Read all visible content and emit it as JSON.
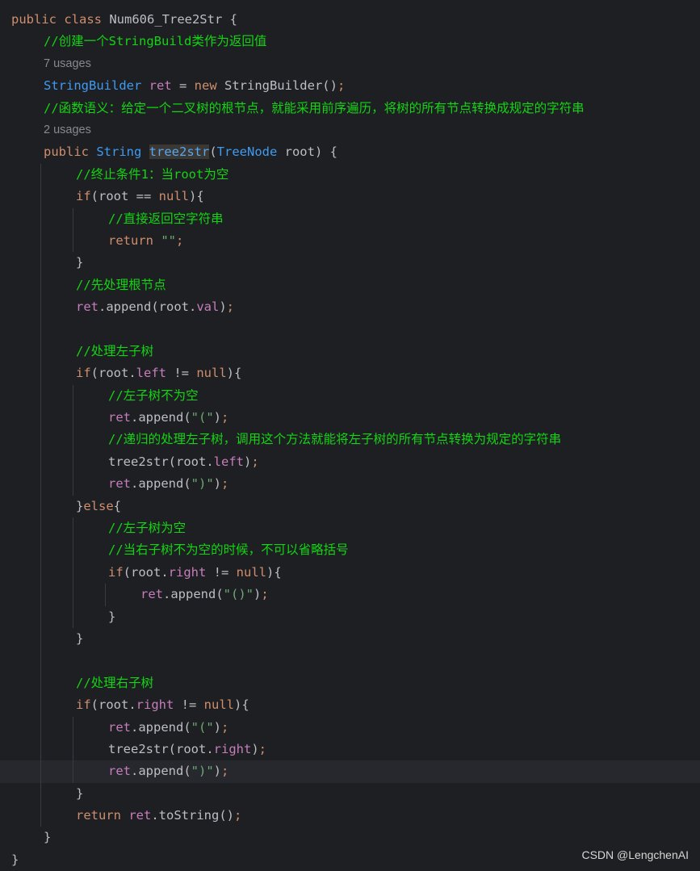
{
  "colors": {
    "background": "#1e1f22",
    "current_line": "#26282e",
    "keyword": "#cf8e6d",
    "plain": "#bcbec4",
    "type": "#3f9bf2",
    "field": "#c77dbb",
    "string": "#6aab73",
    "comment": "#14d414",
    "hint": "#868991"
  },
  "editor": {
    "lines": [
      {
        "indent": 0,
        "tokens": [
          {
            "t": "public class ",
            "c": "kw"
          },
          {
            "t": "Num606_Tree2Str",
            "c": "plain"
          },
          {
            "t": " {",
            "c": "plain"
          }
        ]
      },
      {
        "indent": 1,
        "tokens": [
          {
            "t": "//创建一个StringBuild类作为返回值",
            "c": "comment"
          }
        ]
      },
      {
        "indent": 1,
        "hint": true,
        "tokens": [
          {
            "t": "7 usages",
            "c": "hint"
          }
        ]
      },
      {
        "indent": 1,
        "tokens": [
          {
            "t": "StringBuilder ",
            "c": "type"
          },
          {
            "t": "ret",
            "c": "field"
          },
          {
            "t": " = ",
            "c": "plain"
          },
          {
            "t": "new",
            "c": "kw"
          },
          {
            "t": " StringBuilder()",
            "c": "plain"
          },
          {
            "t": ";",
            "c": "kw"
          }
        ]
      },
      {
        "indent": 1,
        "tokens": [
          {
            "t": "//函数语义：给定一个二叉树的根节点，就能采用前序遍历，将树的所有节点转换成规定的字符串",
            "c": "comment"
          }
        ]
      },
      {
        "indent": 1,
        "hint": true,
        "tokens": [
          {
            "t": "2 usages",
            "c": "hint"
          }
        ]
      },
      {
        "indent": 1,
        "tokens": [
          {
            "t": "public ",
            "c": "kw"
          },
          {
            "t": "String ",
            "c": "type"
          },
          {
            "t": "tree2str",
            "c": "method",
            "hl": true
          },
          {
            "t": "(",
            "c": "plain"
          },
          {
            "t": "TreeNode",
            "c": "type"
          },
          {
            "t": " root) {",
            "c": "plain"
          }
        ]
      },
      {
        "indent": 2,
        "tokens": [
          {
            "t": "//终止条件1：当root为空",
            "c": "comment"
          }
        ]
      },
      {
        "indent": 2,
        "tokens": [
          {
            "t": "if",
            "c": "kw"
          },
          {
            "t": "(root == ",
            "c": "plain"
          },
          {
            "t": "null",
            "c": "kw"
          },
          {
            "t": "){",
            "c": "plain"
          }
        ]
      },
      {
        "indent": 3,
        "tokens": [
          {
            "t": "//直接返回空字符串",
            "c": "comment"
          }
        ]
      },
      {
        "indent": 3,
        "tokens": [
          {
            "t": "return ",
            "c": "kw"
          },
          {
            "t": "\"\"",
            "c": "str"
          },
          {
            "t": ";",
            "c": "kw"
          }
        ]
      },
      {
        "indent": 2,
        "tokens": [
          {
            "t": "}",
            "c": "plain"
          }
        ]
      },
      {
        "indent": 2,
        "tokens": [
          {
            "t": "//先处理根节点",
            "c": "comment"
          }
        ]
      },
      {
        "indent": 2,
        "tokens": [
          {
            "t": "ret",
            "c": "field"
          },
          {
            "t": ".append(root.",
            "c": "plain"
          },
          {
            "t": "val",
            "c": "field"
          },
          {
            "t": ")",
            "c": "plain"
          },
          {
            "t": ";",
            "c": "kw"
          }
        ]
      },
      {
        "indent": 2,
        "tokens": []
      },
      {
        "indent": 2,
        "tokens": [
          {
            "t": "//处理左子树",
            "c": "comment"
          }
        ]
      },
      {
        "indent": 2,
        "tokens": [
          {
            "t": "if",
            "c": "kw"
          },
          {
            "t": "(root.",
            "c": "plain"
          },
          {
            "t": "left",
            "c": "field"
          },
          {
            "t": " != ",
            "c": "plain"
          },
          {
            "t": "null",
            "c": "kw"
          },
          {
            "t": "){",
            "c": "plain"
          }
        ]
      },
      {
        "indent": 3,
        "tokens": [
          {
            "t": "//左子树不为空",
            "c": "comment"
          }
        ]
      },
      {
        "indent": 3,
        "tokens": [
          {
            "t": "ret",
            "c": "field"
          },
          {
            "t": ".append(",
            "c": "plain"
          },
          {
            "t": "\"(\"",
            "c": "str"
          },
          {
            "t": ")",
            "c": "plain"
          },
          {
            "t": ";",
            "c": "kw"
          }
        ]
      },
      {
        "indent": 3,
        "tokens": [
          {
            "t": "//递归的处理左子树，调用这个方法就能将左子树的所有节点转换为规定的字符串",
            "c": "comment"
          }
        ]
      },
      {
        "indent": 3,
        "tokens": [
          {
            "t": "tree2str(root.",
            "c": "plain"
          },
          {
            "t": "left",
            "c": "field"
          },
          {
            "t": ")",
            "c": "plain"
          },
          {
            "t": ";",
            "c": "kw"
          }
        ]
      },
      {
        "indent": 3,
        "tokens": [
          {
            "t": "ret",
            "c": "field"
          },
          {
            "t": ".append(",
            "c": "plain"
          },
          {
            "t": "\")\"",
            "c": "str"
          },
          {
            "t": ")",
            "c": "plain"
          },
          {
            "t": ";",
            "c": "kw"
          }
        ]
      },
      {
        "indent": 2,
        "tokens": [
          {
            "t": "}",
            "c": "plain"
          },
          {
            "t": "else",
            "c": "kw"
          },
          {
            "t": "{",
            "c": "plain"
          }
        ]
      },
      {
        "indent": 3,
        "tokens": [
          {
            "t": "//左子树为空",
            "c": "comment"
          }
        ]
      },
      {
        "indent": 3,
        "tokens": [
          {
            "t": "//当右子树不为空的时候，不可以省略括号",
            "c": "comment"
          }
        ]
      },
      {
        "indent": 3,
        "tokens": [
          {
            "t": "if",
            "c": "kw"
          },
          {
            "t": "(root.",
            "c": "plain"
          },
          {
            "t": "right",
            "c": "field"
          },
          {
            "t": " != ",
            "c": "plain"
          },
          {
            "t": "null",
            "c": "kw"
          },
          {
            "t": "){",
            "c": "plain"
          }
        ]
      },
      {
        "indent": 4,
        "tokens": [
          {
            "t": "ret",
            "c": "field"
          },
          {
            "t": ".append(",
            "c": "plain"
          },
          {
            "t": "\"()\"",
            "c": "str"
          },
          {
            "t": ")",
            "c": "plain"
          },
          {
            "t": ";",
            "c": "kw"
          }
        ]
      },
      {
        "indent": 3,
        "tokens": [
          {
            "t": "}",
            "c": "plain"
          }
        ]
      },
      {
        "indent": 2,
        "tokens": [
          {
            "t": "}",
            "c": "plain"
          }
        ]
      },
      {
        "indent": 2,
        "tokens": []
      },
      {
        "indent": 2,
        "tokens": [
          {
            "t": "//处理右子树",
            "c": "comment"
          }
        ]
      },
      {
        "indent": 2,
        "tokens": [
          {
            "t": "if",
            "c": "kw"
          },
          {
            "t": "(root.",
            "c": "plain"
          },
          {
            "t": "right",
            "c": "field"
          },
          {
            "t": " != ",
            "c": "plain"
          },
          {
            "t": "null",
            "c": "kw"
          },
          {
            "t": "){",
            "c": "plain"
          }
        ]
      },
      {
        "indent": 3,
        "tokens": [
          {
            "t": "ret",
            "c": "field"
          },
          {
            "t": ".append(",
            "c": "plain"
          },
          {
            "t": "\"(\"",
            "c": "str"
          },
          {
            "t": ")",
            "c": "plain"
          },
          {
            "t": ";",
            "c": "kw"
          }
        ]
      },
      {
        "indent": 3,
        "tokens": [
          {
            "t": "tree2str(root.",
            "c": "plain"
          },
          {
            "t": "right",
            "c": "field"
          },
          {
            "t": ")",
            "c": "plain"
          },
          {
            "t": ";",
            "c": "kw"
          }
        ]
      },
      {
        "indent": 3,
        "current": true,
        "tokens": [
          {
            "t": "ret",
            "c": "field"
          },
          {
            "t": ".append(",
            "c": "plain"
          },
          {
            "t": "\")\"",
            "c": "str"
          },
          {
            "t": ")",
            "c": "plain"
          },
          {
            "t": ";",
            "c": "kw"
          }
        ]
      },
      {
        "indent": 2,
        "tokens": [
          {
            "t": "}",
            "c": "plain"
          }
        ]
      },
      {
        "indent": 2,
        "tokens": [
          {
            "t": "return ",
            "c": "kw"
          },
          {
            "t": "ret",
            "c": "field"
          },
          {
            "t": ".toString()",
            "c": "plain"
          },
          {
            "t": ";",
            "c": "kw"
          }
        ]
      },
      {
        "indent": 1,
        "tokens": [
          {
            "t": "}",
            "c": "plain"
          }
        ]
      },
      {
        "indent": 0,
        "tokens": [
          {
            "t": "}",
            "c": "plain"
          }
        ]
      }
    ]
  },
  "watermark": "CSDN @LengchenAI"
}
